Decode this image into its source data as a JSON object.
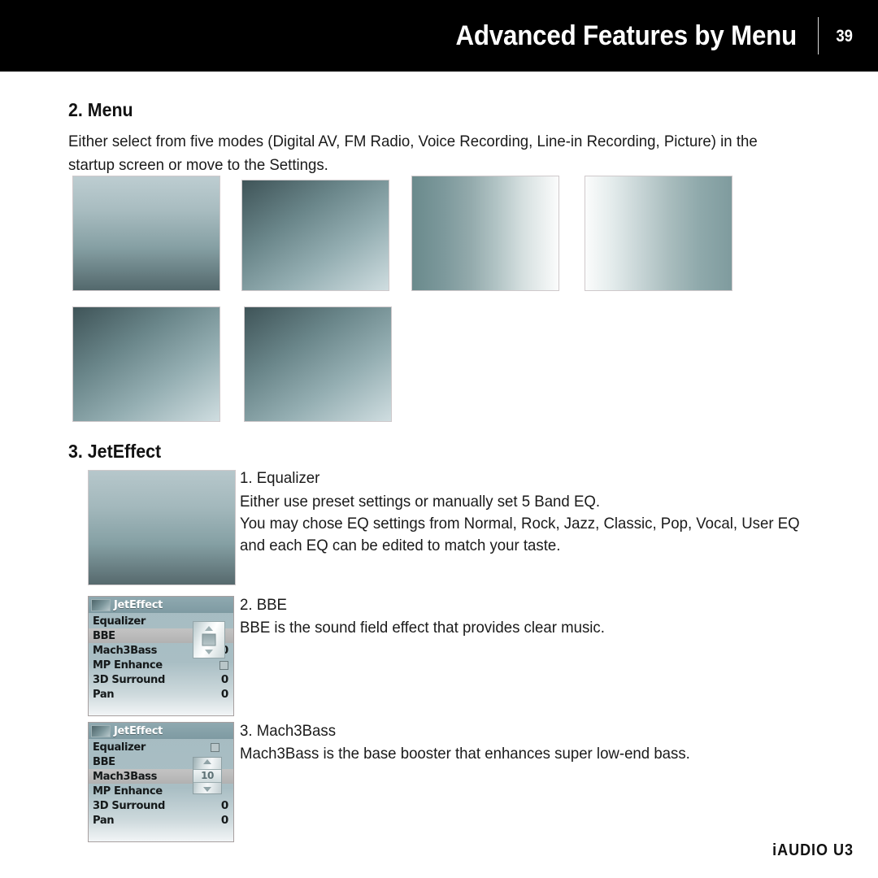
{
  "header": {
    "title": "Advanced Features by Menu",
    "page_number": "39"
  },
  "sections": {
    "menu": {
      "heading": "2. Menu",
      "paragraph_line1": "Either select from five modes (Digital AV, FM Radio, Voice Recording, Line-in Recording, Picture) in the",
      "paragraph_line2": "startup screen or move to the Settings."
    },
    "jeteffect": {
      "heading": "3. JetEffect",
      "items": [
        {
          "title": "1. Equalizer",
          "lines": [
            "Either use preset settings or manually set 5 Band EQ.",
            "You may chose EQ settings from Normal, Rock, Jazz, Classic, Pop, Vocal, User EQ",
            "and each EQ can be edited to match your taste."
          ]
        },
        {
          "title": "2. BBE",
          "lines": [
            "BBE is the sound field effect that provides clear music."
          ]
        },
        {
          "title": "3. Mach3Bass",
          "lines": [
            "Mach3Bass is the base booster that enhances super low-end bass."
          ]
        }
      ]
    }
  },
  "device_screens": [
    {
      "title": "JetEffect",
      "selected": "BBE",
      "rows": [
        {
          "label": "Equalizer",
          "value": ""
        },
        {
          "label": "BBE",
          "value": ""
        },
        {
          "label": "Mach3Bass",
          "value": "10"
        },
        {
          "label": "MP Enhance",
          "value": "checkbox"
        },
        {
          "label": "3D Surround",
          "value": "0"
        },
        {
          "label": "Pan",
          "value": "0"
        }
      ],
      "overlay": {
        "kind": "joystick",
        "value": ""
      }
    },
    {
      "title": "JetEffect",
      "selected": "Mach3Bass",
      "rows": [
        {
          "label": "Equalizer",
          "value": ""
        },
        {
          "label": "BBE",
          "value": ""
        },
        {
          "label": "Mach3Bass",
          "value": "10"
        },
        {
          "label": "MP Enhance",
          "value": "checkbox"
        },
        {
          "label": "3D Surround",
          "value": "0"
        },
        {
          "label": "Pan",
          "value": "0"
        }
      ],
      "overlay": {
        "kind": "spinner",
        "value": "10"
      }
    }
  ],
  "footer": {
    "product": "iAUDIO U3"
  },
  "colors": {
    "header_bg": "#000000",
    "header_text": "#ffffff",
    "body_text": "#1a1a1a",
    "lcd_title_bar": "#7e9aa2",
    "lcd_selected_row": "#b8b8b8"
  }
}
